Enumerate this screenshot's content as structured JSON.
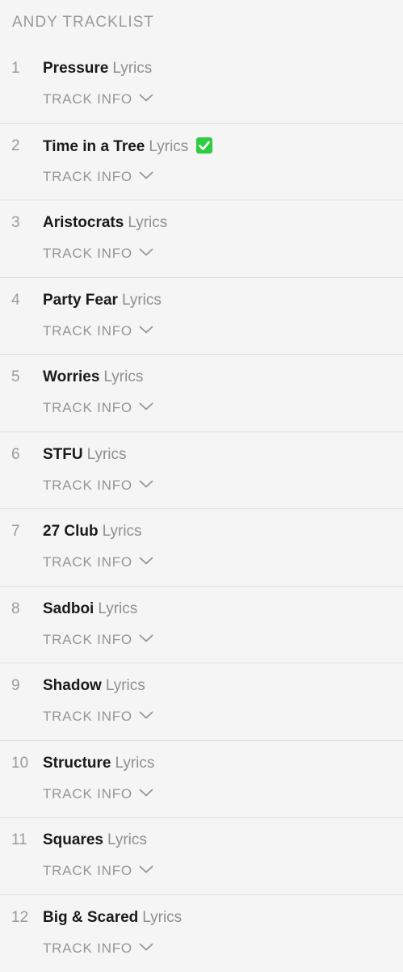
{
  "tracklist": {
    "title": "ANDY TRACKLIST",
    "track_info_label": "TRACK INFO",
    "lyrics_label": "Lyrics",
    "tracks": [
      {
        "number": "1",
        "title": "Pressure",
        "verified": false
      },
      {
        "number": "2",
        "title": "Time in a Tree",
        "verified": true
      },
      {
        "number": "3",
        "title": "Aristocrats",
        "verified": false
      },
      {
        "number": "4",
        "title": "Party Fear",
        "verified": false
      },
      {
        "number": "5",
        "title": "Worries",
        "verified": false
      },
      {
        "number": "6",
        "title": "STFU",
        "verified": false
      },
      {
        "number": "7",
        "title": "27 Club",
        "verified": false
      },
      {
        "number": "8",
        "title": "Sadboi",
        "verified": false
      },
      {
        "number": "9",
        "title": "Shadow",
        "verified": false
      },
      {
        "number": "10",
        "title": "Structure",
        "verified": false
      },
      {
        "number": "11",
        "title": "Squares",
        "verified": false
      },
      {
        "number": "12",
        "title": "Big & Scared",
        "verified": false
      }
    ]
  },
  "colors": {
    "background": "#f5f5f5",
    "verified_badge": "#2ecc40",
    "muted_text": "#959595",
    "title_text": "#1a1a1a"
  },
  "icons": {
    "expand": "chevron-down-icon",
    "verified": "check-badge-icon"
  }
}
